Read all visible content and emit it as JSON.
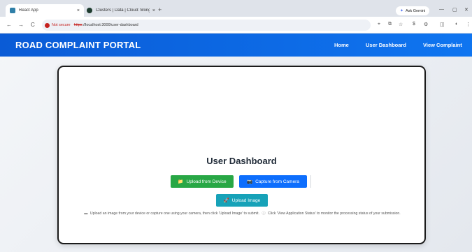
{
  "browser": {
    "tabs": [
      {
        "title": "React App",
        "icon": "react-favicon",
        "close": "×"
      },
      {
        "title": "Clusters | Data | Cloud: MongoD",
        "icon": "mongodb-favicon",
        "close": "×"
      }
    ],
    "new_tab": "+",
    "ask_gemini": "Ask Gemini",
    "window_controls": {
      "minimize": "—",
      "restore": "▢",
      "close": "✕"
    },
    "nav": {
      "back": "←",
      "forward": "→",
      "reload": "C"
    },
    "security_label": "Not secure",
    "url_scheme": "https",
    "url_rest": "://localhost:3000/user-dashboard",
    "toolbar_icons": {
      "location": "⌖",
      "share": "⧉",
      "star": "☆",
      "extension": "$",
      "puzzle": "⚙",
      "sidebar": "◫",
      "profile": "◐",
      "menu": "⋮"
    }
  },
  "navbar": {
    "brand": "ROAD COMPLAINT PORTAL",
    "links": [
      "Home",
      "User Dashboard",
      "View Complaint"
    ]
  },
  "dashboard": {
    "title": "User Dashboard",
    "upload_device": "Upload from Device",
    "capture_camera": "Capture from Camera",
    "upload_image": "Upload Image",
    "icons": {
      "folder": "📁",
      "camera": "📷",
      "rocket": "🚀",
      "note": "▬",
      "info": "ⓘ"
    },
    "instruction_1": "Upload an image from your device or capture one using your camera, then click 'Upload Image' to submit.",
    "instruction_2": "Click 'View Application Status' to monitor the processing status of your submission."
  },
  "colors": {
    "navbar": "#0a5bd6",
    "green_button": "#28a745",
    "blue_button": "#0d6efd",
    "teal_button": "#17a2b8"
  }
}
